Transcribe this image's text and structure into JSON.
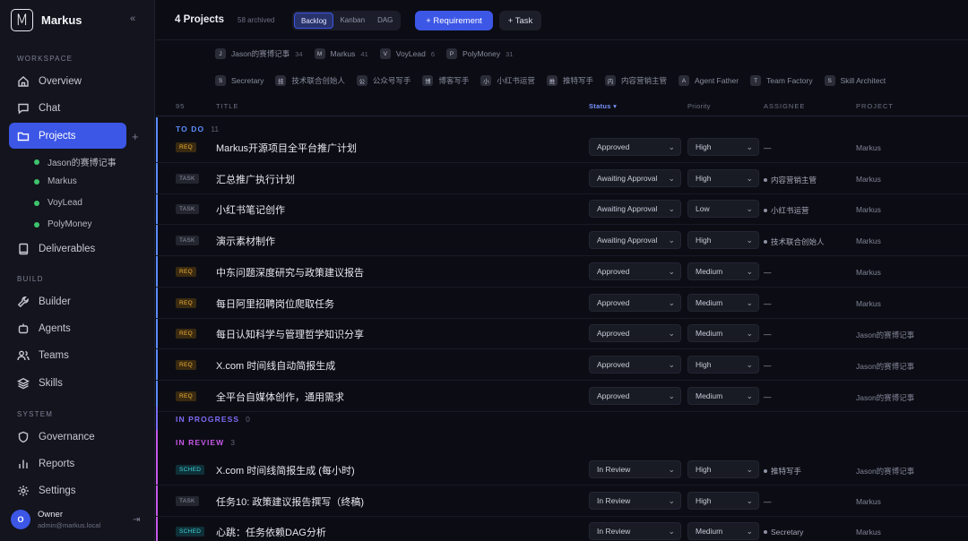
{
  "app": {
    "name": "Markus",
    "logo_letter": "M",
    "collapse_icon": "double-chevron-left-icon"
  },
  "sidebar": {
    "workspace_label": "WORKSPACE",
    "workspace_items": [
      {
        "label": "Overview",
        "icon": "home-icon"
      },
      {
        "label": "Chat",
        "icon": "chat-icon"
      },
      {
        "label": "Projects",
        "icon": "folder-icon",
        "active": true
      },
      {
        "label": "Deliverables",
        "icon": "book-icon"
      }
    ],
    "projects": [
      "Jason的赛博记事",
      "Markus",
      "VoyLead",
      "PolyMoney"
    ],
    "build_label": "BUILD",
    "build_items": [
      {
        "label": "Builder",
        "icon": "wrench-icon"
      },
      {
        "label": "Agents",
        "icon": "agent-icon"
      },
      {
        "label": "Teams",
        "icon": "users-icon"
      },
      {
        "label": "Skills",
        "icon": "layers-icon"
      }
    ],
    "system_label": "SYSTEM",
    "system_items": [
      {
        "label": "Governance",
        "icon": "shield-icon"
      },
      {
        "label": "Reports",
        "icon": "bar-chart-icon"
      },
      {
        "label": "Settings",
        "icon": "gear-icon"
      }
    ],
    "owner": {
      "initial": "O",
      "name": "Owner",
      "email": "admin@markus.local"
    }
  },
  "header": {
    "title": "4 Projects",
    "archived": "58 archived",
    "views": [
      "Backlog",
      "Kanban",
      "DAG"
    ],
    "active_view": "Backlog",
    "add_requirement": "+ Requirement",
    "add_task": "+ Task"
  },
  "project_filters": [
    {
      "badge": "J",
      "label": "Jason的赛博记事",
      "count": "34"
    },
    {
      "badge": "M",
      "label": "Markus",
      "count": "41"
    },
    {
      "badge": "V",
      "label": "VoyLead",
      "count": "6"
    },
    {
      "badge": "P",
      "label": "PolyMoney",
      "count": "31"
    }
  ],
  "agent_filters": [
    {
      "badge": "S",
      "label": "Secretary"
    },
    {
      "badge": "技",
      "label": "技术联合创始人"
    },
    {
      "badge": "公",
      "label": "公众号写手"
    },
    {
      "badge": "博",
      "label": "博客写手"
    },
    {
      "badge": "小",
      "label": "小红书运营"
    },
    {
      "badge": "推",
      "label": "推特写手"
    },
    {
      "badge": "内",
      "label": "内容营销主管"
    },
    {
      "badge": "A",
      "label": "Agent Father"
    },
    {
      "badge": "T",
      "label": "Team Factory"
    },
    {
      "badge": "S",
      "label": "Skill Architect"
    }
  ],
  "table_header": {
    "count": "95",
    "title": "TITLE",
    "status": "Status ▾",
    "priority": "Priority",
    "assignee": "ASSIGNEE",
    "project": "PROJECT"
  },
  "groups": {
    "todo": {
      "label": "TO DO",
      "count": "11"
    },
    "inprogress": {
      "label": "IN PROGRESS",
      "count": "0"
    },
    "inreview": {
      "label": "IN REVIEW",
      "count": "3"
    }
  },
  "todo_rows": [
    {
      "tag": "REQ",
      "title": "Markus开源项目全平台推广计划",
      "status": "Approved",
      "priority": "High",
      "assignee": "—",
      "project": "Markus"
    },
    {
      "tag": "TASK",
      "title": "汇总推广执行计划",
      "status": "Awaiting Approval",
      "priority": "High",
      "assignee": "内容营销主管",
      "project": "Markus"
    },
    {
      "tag": "TASK",
      "title": "小红书笔记创作",
      "status": "Awaiting Approval",
      "priority": "Low",
      "assignee": "小红书运营",
      "project": "Markus"
    },
    {
      "tag": "TASK",
      "title": "演示素材制作",
      "status": "Awaiting Approval",
      "priority": "High",
      "assignee": "技术联合创始人",
      "project": "Markus"
    },
    {
      "tag": "REQ",
      "title": "中东问题深度研究与政策建议报告",
      "status": "Approved",
      "priority": "Medium",
      "assignee": "—",
      "project": "Markus"
    },
    {
      "tag": "REQ",
      "title": "每日阿里招聘岗位爬取任务",
      "status": "Approved",
      "priority": "Medium",
      "assignee": "—",
      "project": "Markus"
    },
    {
      "tag": "REQ",
      "title": "每日认知科学与管理哲学知识分享",
      "status": "Approved",
      "priority": "Medium",
      "assignee": "—",
      "project": "Jason的赛博记事"
    },
    {
      "tag": "REQ",
      "title": "X.com 时间线自动简报生成",
      "status": "Approved",
      "priority": "High",
      "assignee": "—",
      "project": "Jason的赛博记事"
    },
    {
      "tag": "REQ",
      "title": "全平台自媒体创作，通用需求",
      "status": "Approved",
      "priority": "Medium",
      "assignee": "—",
      "project": "Jason的赛博记事"
    }
  ],
  "review_rows": [
    {
      "tag": "SCHED",
      "title": "X.com 时间线简报生成 (每小时)",
      "status": "In Review",
      "priority": "High",
      "assignee": "推特写手",
      "project": "Jason的赛博记事"
    },
    {
      "tag": "TASK",
      "title": "任务10: 政策建议报告撰写（终稿)",
      "status": "In Review",
      "priority": "High",
      "assignee": "—",
      "project": "Markus"
    },
    {
      "tag": "SCHED",
      "title": "心跳：任务依赖DAG分析",
      "status": "In Review",
      "priority": "Medium",
      "assignee": "Secretary",
      "project": "Markus"
    }
  ],
  "colors": {
    "accent": "#3c56e6",
    "todo": "#5b8cff",
    "inprogress": "#7c6cf6",
    "inreview": "#c658e8"
  }
}
